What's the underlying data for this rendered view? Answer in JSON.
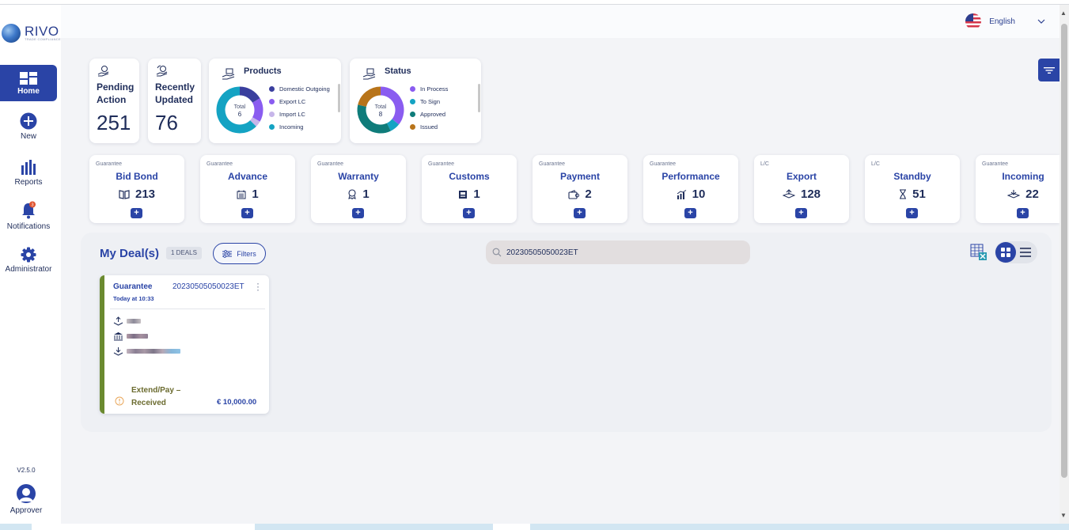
{
  "sidebar": {
    "logo_text": "RIVO",
    "logo_sub": "TRADE COMPLIANCE",
    "items": [
      {
        "label": "Home",
        "icon": "dashboard-icon"
      },
      {
        "label": "New",
        "icon": "plus-circle-icon"
      },
      {
        "label": "Reports",
        "icon": "bar-chart-icon"
      },
      {
        "label": "Notifications",
        "icon": "bell-icon",
        "badge": "3"
      },
      {
        "label": "Administrator",
        "icon": "gear-icon"
      }
    ],
    "version": "V2.5.0",
    "user_label": "Approver"
  },
  "header": {
    "language": "English"
  },
  "stats": {
    "pending": {
      "title_line1": "Pending",
      "title_line2": "Action",
      "value": "251"
    },
    "recent": {
      "title_line1": "Recently",
      "title_line2": "Updated",
      "value": "76"
    }
  },
  "products_chart": {
    "title": "Products",
    "center_label": "Total",
    "center_value": "6",
    "legend": [
      {
        "label": "Domestic Outgoing",
        "color": "#3a3f9e"
      },
      {
        "label": "Export LC",
        "color": "#8a5cf0"
      },
      {
        "label": "Import LC",
        "color": "#c7b6ea"
      },
      {
        "label": "Incoming",
        "color": "#14a3c3"
      }
    ]
  },
  "status_chart": {
    "title": "Status",
    "center_label": "Total",
    "center_value": "8",
    "legend": [
      {
        "label": "In Process",
        "color": "#8a5cf0"
      },
      {
        "label": "To Sign",
        "color": "#14a3c3"
      },
      {
        "label": "Approved",
        "color": "#0f7c7a"
      },
      {
        "label": "Issued",
        "color": "#b8741a"
      }
    ]
  },
  "chart_data": [
    {
      "type": "pie",
      "title": "Products",
      "categories": [
        "Domestic Outgoing",
        "Export LC",
        "Import LC",
        "Incoming"
      ],
      "values": [
        1,
        1,
        0.25,
        3.75
      ],
      "total": 6
    },
    {
      "type": "pie",
      "title": "Status",
      "categories": [
        "In Process",
        "To Sign",
        "Approved",
        "Issued"
      ],
      "values": [
        2.5,
        0.5,
        2.5,
        1.5
      ],
      "total": 8
    }
  ],
  "products": [
    {
      "category": "Guarantee",
      "name": "Bid Bond",
      "count": "213",
      "icon": "book-icon"
    },
    {
      "category": "Guarantee",
      "name": "Advance",
      "count": "1",
      "icon": "calendar-icon"
    },
    {
      "category": "Guarantee",
      "name": "Warranty",
      "count": "1",
      "icon": "award-icon"
    },
    {
      "category": "Guarantee",
      "name": "Customs",
      "count": "1",
      "icon": "building-icon"
    },
    {
      "category": "Guarantee",
      "name": "Payment",
      "count": "2",
      "icon": "wallet-icon"
    },
    {
      "category": "Guarantee",
      "name": "Performance",
      "count": "10",
      "icon": "chart-up-icon"
    },
    {
      "category": "L/C",
      "name": "Export",
      "count": "128",
      "icon": "export-icon"
    },
    {
      "category": "L/C",
      "name": "Standby",
      "count": "51",
      "icon": "hourglass-icon"
    },
    {
      "category": "Guarantee",
      "name": "Incoming",
      "count": "22",
      "icon": "incoming-icon"
    }
  ],
  "add_label": "+",
  "deals": {
    "title": "My Deal(s)",
    "count_label": "1 DEALS",
    "filters_label": "Filters",
    "search_value": "20230505050023ET",
    "cards": [
      {
        "type": "Guarantee",
        "reference": "20230505050023ET",
        "time": "Today at 10:33",
        "status": "Extend/Pay – Received",
        "amount": "€ 10,000.00"
      }
    ]
  }
}
